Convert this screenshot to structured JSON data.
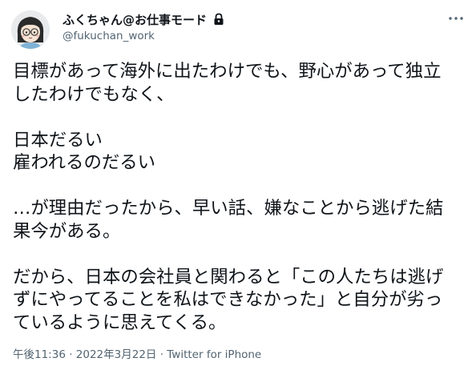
{
  "author": {
    "display_name": "ふくちゃん@お仕事モード",
    "handle": "@fukuchan_work",
    "protected_icon": "lock-icon",
    "avatar_icon": "avatar-illustration"
  },
  "menu_icon": "more-dots-icon",
  "tweet": {
    "lines": [
      "目標があって海外に出たわけでも、野心があって独立",
      "したわけでもなく、",
      "",
      "日本だるい",
      "雇われるのだるい",
      "",
      "…が理由だったから、早い話、嫌なことから逃げた結",
      "果今がある。",
      "",
      "だから、日本の会社員と関わると「この人たちは逃げ",
      "ずにやってることを私はできなかった」と自分が劣っ",
      "ているように思えてくる。"
    ]
  },
  "meta": {
    "time": "午後11:36",
    "separator1": " · ",
    "date": "2022年3月22日",
    "separator2": " · ",
    "client": "Twitter for iPhone"
  }
}
